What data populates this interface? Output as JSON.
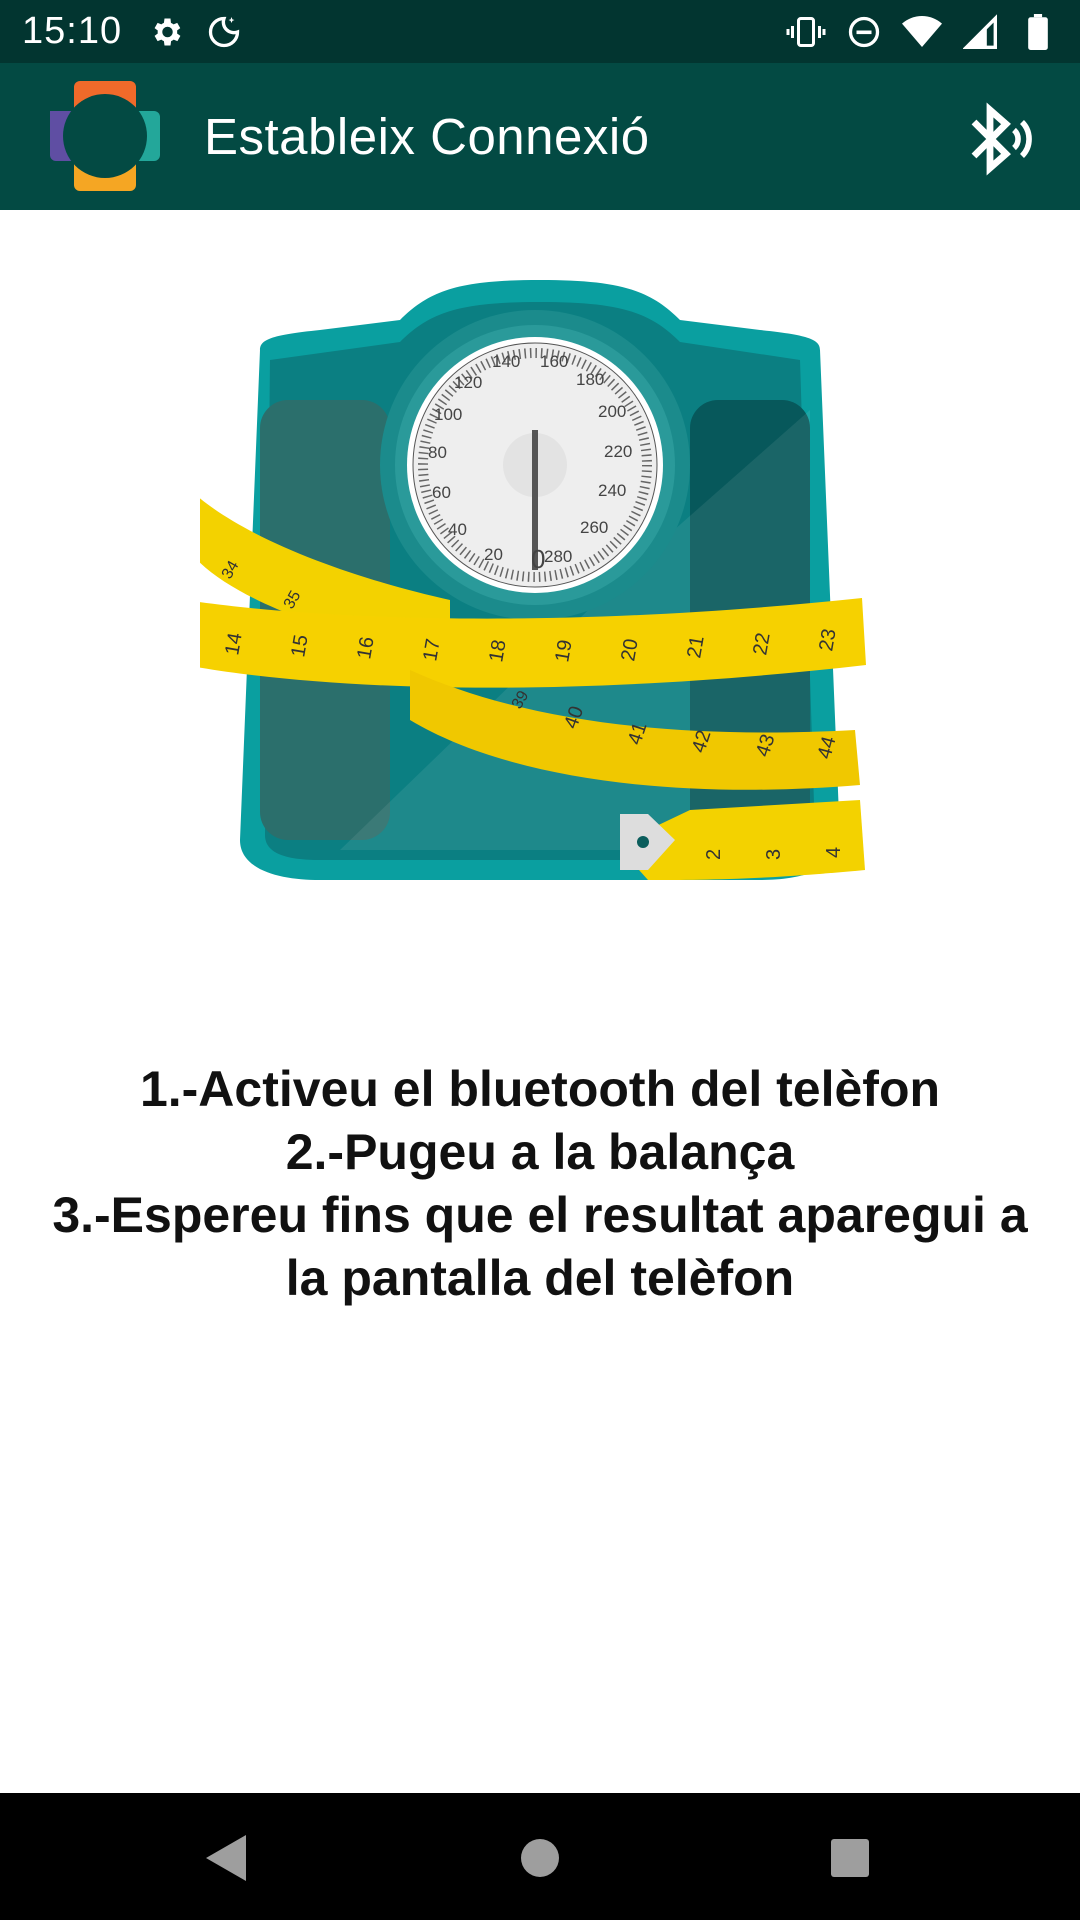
{
  "status_bar": {
    "time": "15:10",
    "left_icons": [
      "gear-icon",
      "do-not-disturb-moon-icon"
    ],
    "right_icons": [
      "vibrate-icon",
      "do-not-disturb-icon",
      "wifi-icon",
      "cell-signal-icon",
      "battery-icon"
    ]
  },
  "app_bar": {
    "title": "Estableix Connexió",
    "logo": "app-logo-icon",
    "action_icon": "bluetooth-searching-icon",
    "colors": {
      "background": "#034a43",
      "status": "#023530"
    }
  },
  "illustration": {
    "subject": "bathroom-scale-with-measuring-tape",
    "dial_labels": [
      "0",
      "20",
      "40",
      "60",
      "80",
      "100",
      "120",
      "140",
      "160",
      "180",
      "200",
      "220",
      "240",
      "260",
      "280"
    ],
    "tape_labels_upper": [
      "34",
      "35",
      "14",
      "15",
      "16",
      "17",
      "18",
      "19",
      "20",
      "21",
      "22",
      "23"
    ],
    "tape_labels_lower": [
      "39",
      "40",
      "41",
      "42",
      "43",
      "44"
    ],
    "tape_end_labels": [
      "2",
      "3",
      "4"
    ]
  },
  "instructions": {
    "line1": "1.-Activeu el bluetooth del telèfon",
    "line2": "2.-Pugeu a la balança",
    "line3": "3.-Espereu fins que el resultat aparegui a la pantalla del telèfon"
  },
  "nav_bar": {
    "icons": [
      "back-icon",
      "home-icon",
      "recents-icon"
    ]
  }
}
